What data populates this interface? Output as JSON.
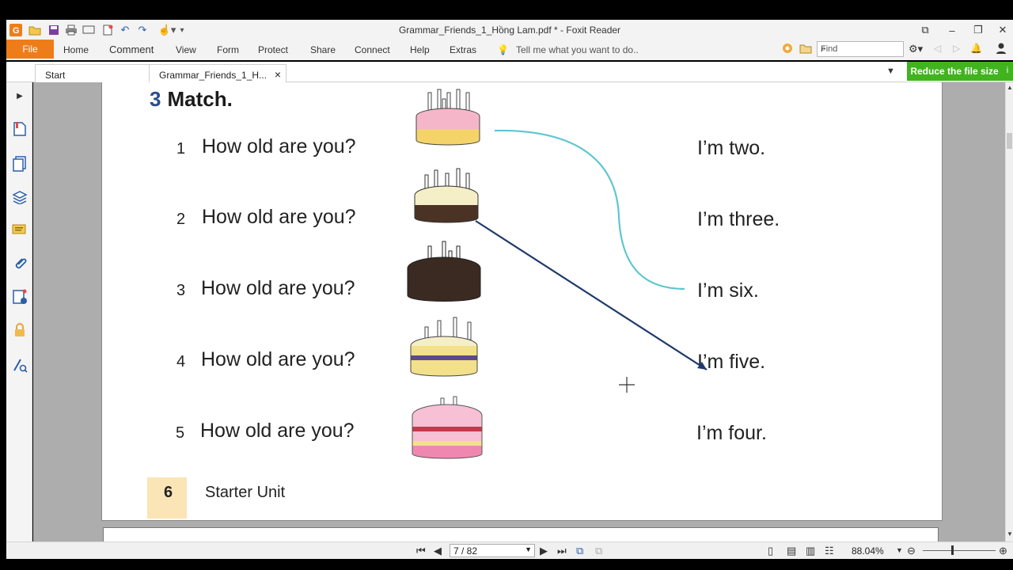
{
  "window": {
    "title": "Grammar_Friends_1_Hồng Lam.pdf * - Foxit Reader"
  },
  "ribbon": {
    "file": "File",
    "menu": [
      "Home",
      "Comment",
      "View",
      "Form",
      "Protect",
      "Share",
      "Connect",
      "Help",
      "Extras"
    ],
    "tell_me": "Tell me what you want to do..",
    "find_placeholder": "Find"
  },
  "tabs": {
    "start": "Start",
    "document": "Grammar_Friends_1_H...",
    "close_glyph": "×",
    "reduce_button": "Reduce the file size"
  },
  "page": {
    "exercise_number": "3",
    "exercise_title": "Match.",
    "questions": [
      {
        "number": "1",
        "text": "How old are you?"
      },
      {
        "number": "2",
        "text": "How old are you?"
      },
      {
        "number": "3",
        "text": "How old are you?"
      },
      {
        "number": "4",
        "text": "How old are you?"
      },
      {
        "number": "5",
        "text": "How old are you?"
      }
    ],
    "answers": [
      "I’m two.",
      "I’m three.",
      "I’m six.",
      "I’m five.",
      "I’m four."
    ],
    "footer_page_number": "6",
    "footer_label": "Starter Unit"
  },
  "statusbar": {
    "page_indicator": "7 / 82",
    "zoom": "88.04%"
  },
  "colors": {
    "file_tab": "#ee7d19",
    "reduce_button": "#41b31f",
    "match_line_1": "#5ec6d0",
    "match_line_2": "#1f3a6b"
  }
}
